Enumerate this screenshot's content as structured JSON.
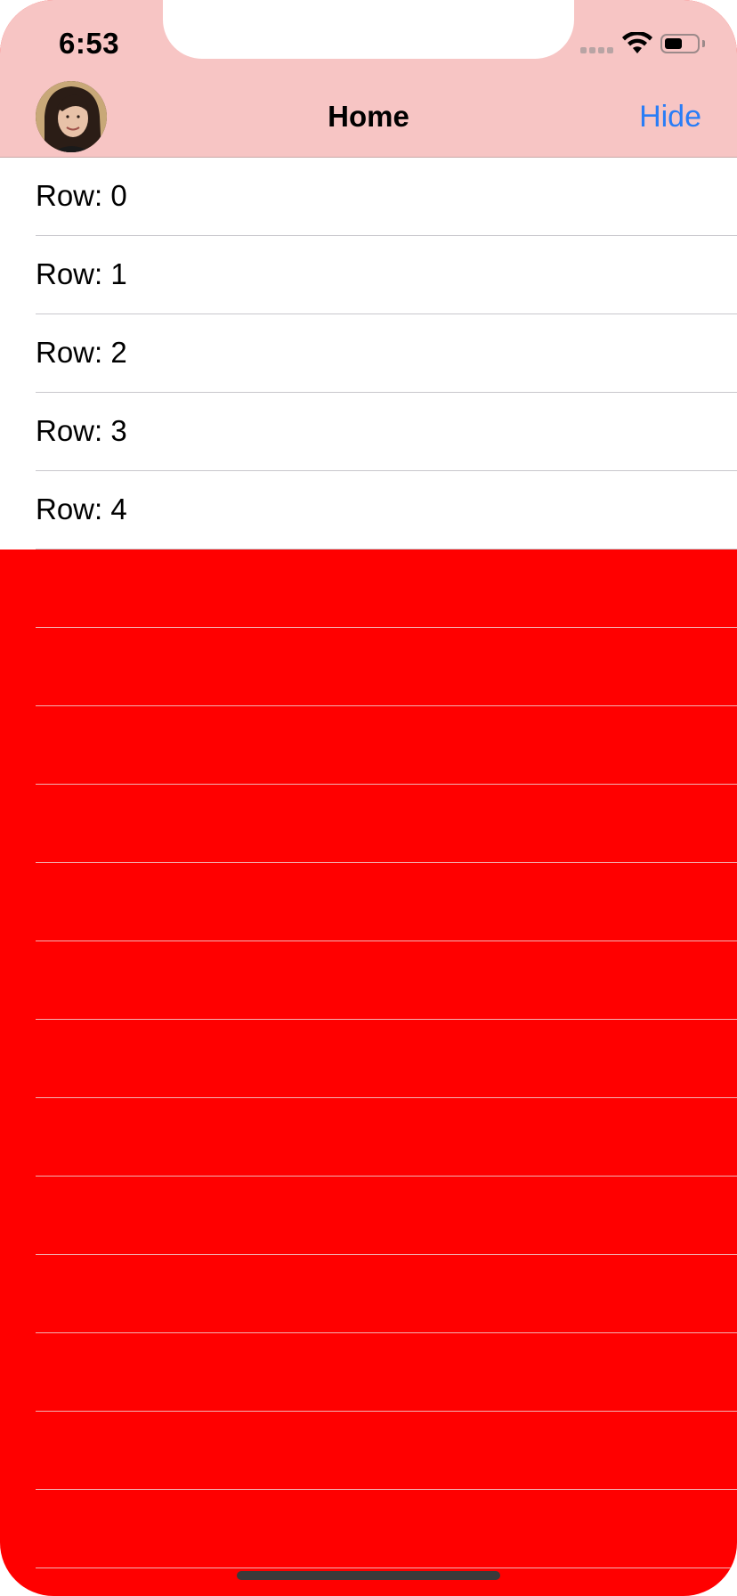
{
  "status_bar": {
    "time": "6:53",
    "battery_level": 0.55
  },
  "nav_bar": {
    "title": "Home",
    "right_button": "Hide",
    "avatar_icon": "avatar-photo"
  },
  "table": {
    "rows": [
      "Row: 0",
      "Row: 1",
      "Row: 2",
      "Row: 3",
      "Row: 4"
    ],
    "empty_row_count": 13
  },
  "colors": {
    "nav_background": "#f7c5c4",
    "table_background": "#ff0000",
    "accent": "#2a7df6"
  }
}
